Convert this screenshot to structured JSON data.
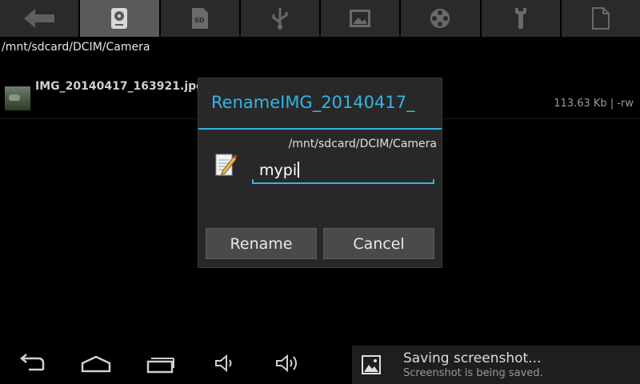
{
  "current_path": "/mnt/sdcard/DCIM/Camera",
  "tabs": [
    {
      "icon": "back-arrow-icon",
      "active": false
    },
    {
      "icon": "internal-storage-icon",
      "active": true
    },
    {
      "icon": "sd-card-icon",
      "active": false
    },
    {
      "icon": "usb-icon",
      "active": false
    },
    {
      "icon": "image-icon",
      "active": false
    },
    {
      "icon": "film-reel-icon",
      "active": false
    },
    {
      "icon": "wrench-icon",
      "active": false
    },
    {
      "icon": "file-icon",
      "active": false
    }
  ],
  "file": {
    "name": "IMG_20140417_163921.jpg",
    "size": "113.63 Kb",
    "perms": "| -rw"
  },
  "dialog": {
    "title": "RenameIMG_20140417_",
    "path": "/mnt/sdcard/DCIM/Camera",
    "input_value": "mypi",
    "rename_label": "Rename",
    "cancel_label": "Cancel",
    "accent_color": "#33b5e5"
  },
  "notification": {
    "title": "Saving screenshot...",
    "subtitle": "Screenshot is being saved."
  },
  "nav_icons": [
    "back-icon",
    "home-icon",
    "recent-apps-icon",
    "volume-down-icon",
    "volume-up-icon"
  ]
}
